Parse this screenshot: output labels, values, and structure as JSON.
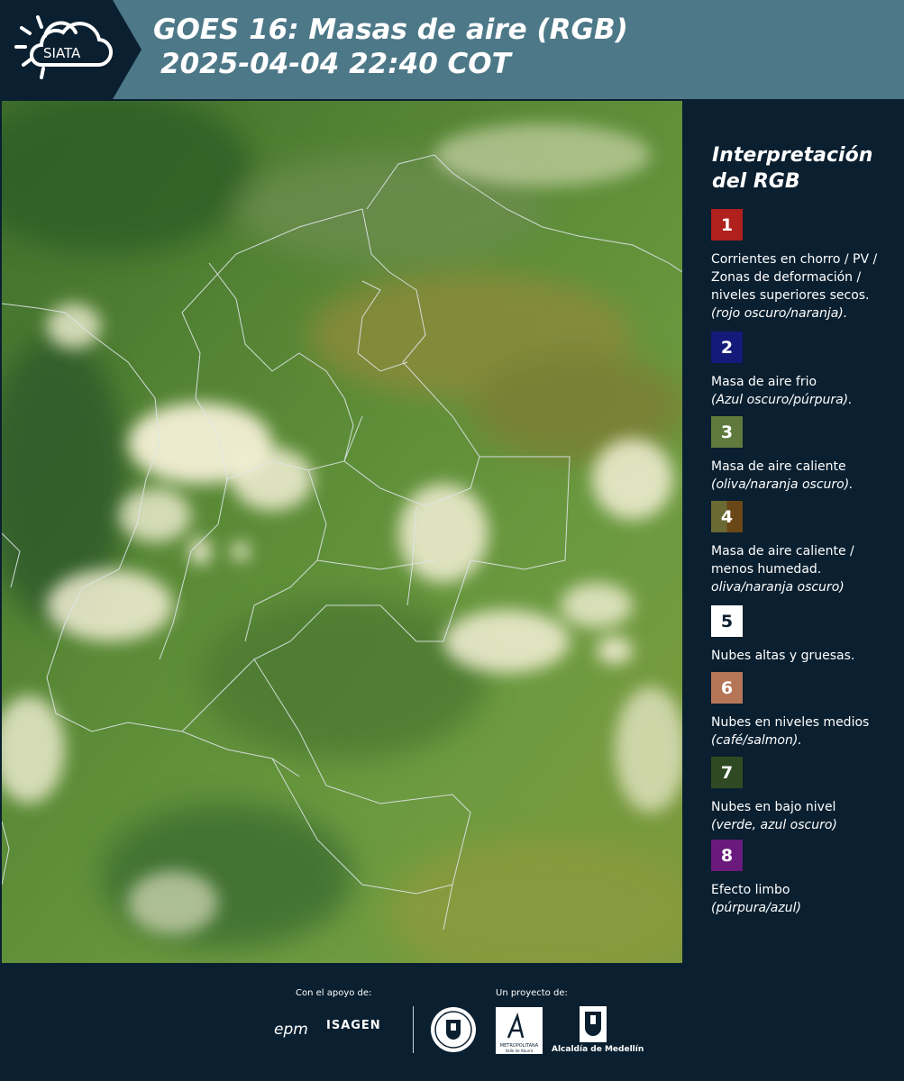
{
  "header": {
    "logo_text": "SIATA",
    "title_line1": "GOES 16: Masas de aire (RGB)",
    "title_line2": "2025-04-04 22:40 COT"
  },
  "legend": {
    "title": "Interpretación del RGB",
    "items": [
      {
        "num": "1",
        "color": "#b0201c",
        "text": "Corrientes en chorro / PV / Zonas de deformación / niveles superiores secos.",
        "note": "(rojo oscuro/naranja)."
      },
      {
        "num": "2",
        "color": "#141a7a",
        "text": "Masa de aire frio",
        "note": "(Azul oscuro/púrpura)."
      },
      {
        "num": "3",
        "color": "#5f7a3c",
        "text": "Masa de aire caliente",
        "note": "(oliva/naranja oscuro)."
      },
      {
        "num": "4",
        "color": "#6b5a28",
        "text": "Masa de aire caliente / menos humedad.",
        "note": "oliva/naranja oscuro)"
      },
      {
        "num": "5",
        "color": "#ffffff",
        "text": "Nubes altas y gruesas.",
        "note": ""
      },
      {
        "num": "6",
        "color": "#b57658",
        "text": "Nubes en niveles medios",
        "note": "(café/salmon)."
      },
      {
        "num": "7",
        "color": "#2f4a22",
        "text": "Nubes en bajo nivel",
        "note": "(verde, azul oscuro)"
      },
      {
        "num": "8",
        "color": "#6a1a7c",
        "text": "Efecto limbo",
        "note": "(púrpura/azul)"
      }
    ]
  },
  "footer": {
    "support_label": "Con el apoyo de:",
    "project_label": "Un proyecto de:",
    "epm": "epm",
    "isagen": "ISAGEN",
    "metropolitana": "METROPOLITANA",
    "metro_sub": "Valle de Aburrá",
    "alcaldia": "Alcaldía de Medellín"
  }
}
